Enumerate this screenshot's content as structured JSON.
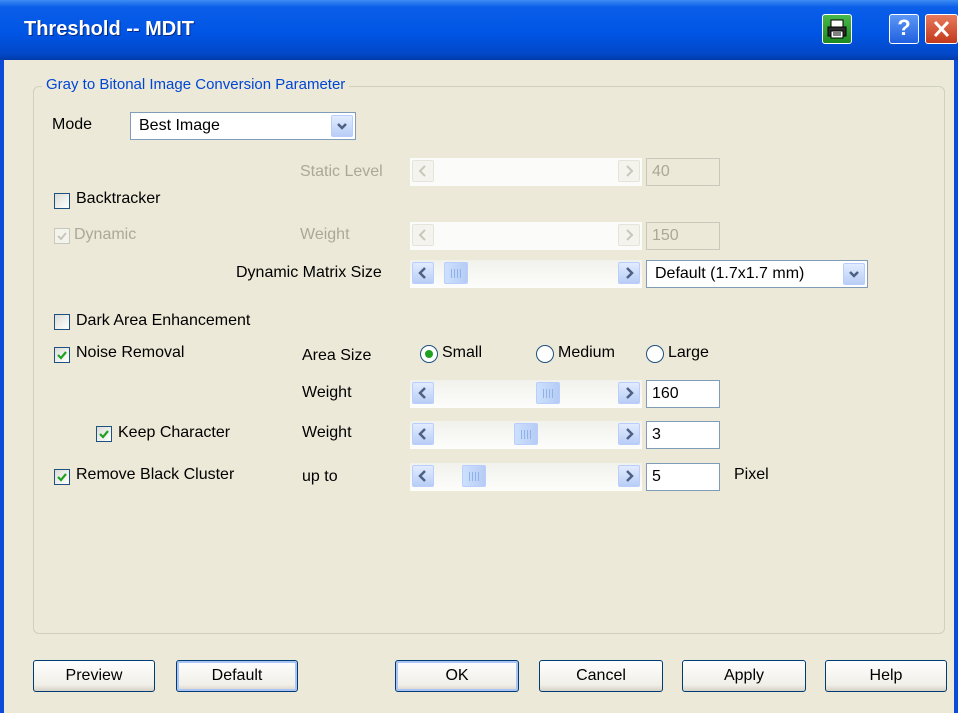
{
  "window": {
    "title": "Threshold -- MDIT",
    "help_glyph": "?",
    "print_icon": "printer-icon",
    "close_icon": "close-icon"
  },
  "group": {
    "title": "Gray to Bitonal Image Conversion Parameter"
  },
  "mode": {
    "label": "Mode",
    "value": "Best Image"
  },
  "static_level": {
    "label": "Static Level",
    "value": "40"
  },
  "backtracker": {
    "label": "Backtracker",
    "checked": false
  },
  "dynamic": {
    "label": "Dynamic",
    "checked": true,
    "enabled": false,
    "weight_label": "Weight",
    "weight_value": "150"
  },
  "matrix": {
    "label": "Dynamic Matrix Size",
    "value": "Default (1.7x1.7 mm)"
  },
  "dark_area": {
    "label": "Dark Area Enhancement",
    "checked": false
  },
  "noise": {
    "label": "Noise Removal",
    "checked": true,
    "area_label": "Area Size",
    "options": [
      "Small",
      "Medium",
      "Large"
    ],
    "selected": "Small",
    "weight_label": "Weight",
    "weight_value": "160"
  },
  "keep_character": {
    "label": "Keep Character",
    "checked": true,
    "weight_label": "Weight",
    "weight_value": "3"
  },
  "black_cluster": {
    "label": "Remove Black Cluster",
    "checked": true,
    "upto_label": "up to",
    "value": "5",
    "unit": "Pixel"
  },
  "buttons": {
    "preview": "Preview",
    "default": "Default",
    "ok": "OK",
    "cancel": "Cancel",
    "apply": "Apply",
    "help": "Help"
  },
  "icons": {
    "check": "✔",
    "arrow_left": "‹",
    "arrow_right": "›",
    "chevron_down": "⌄"
  },
  "colors": {
    "titlebar": "#0055e5",
    "group_title": "#0046d5",
    "face": "#ece9d8"
  }
}
